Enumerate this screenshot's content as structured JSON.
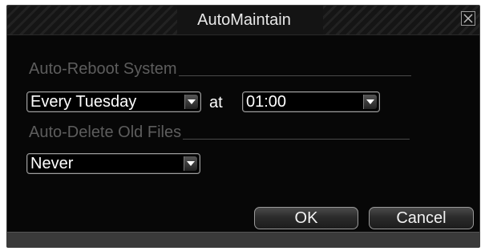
{
  "dialog": {
    "title": "AutoMaintain",
    "close_icon": "close-x-icon"
  },
  "auto_reboot": {
    "section_label": "Auto-Reboot System",
    "schedule_value": "Every Tuesday",
    "at_label": "at",
    "time_value": "01:00"
  },
  "auto_delete": {
    "section_label": "Auto-Delete Old Files",
    "value": "Never"
  },
  "buttons": {
    "ok_label": "OK",
    "cancel_label": "Cancel"
  }
}
